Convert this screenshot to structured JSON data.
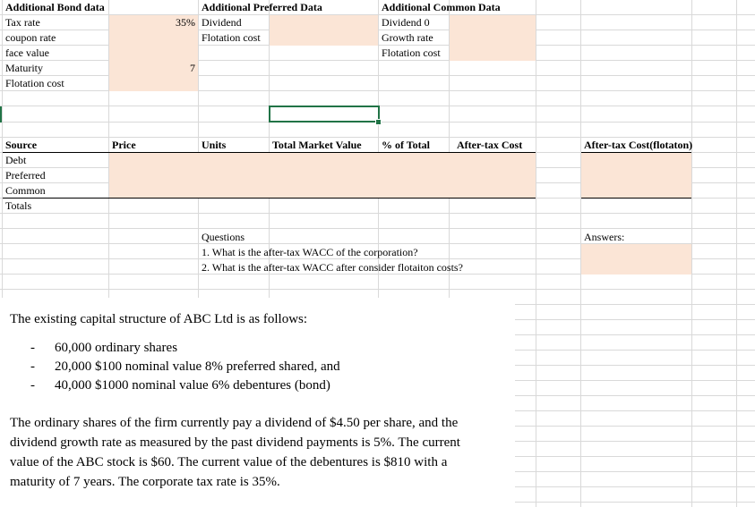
{
  "bond": {
    "header": "Additional Bond data",
    "tax_rate_label": "Tax rate",
    "tax_rate_value": "35%",
    "coupon_rate_label": "coupon rate",
    "face_value_label": "face value",
    "maturity_label": "Maturity",
    "maturity_value": "7",
    "flotation_label": "Flotation cost"
  },
  "preferred": {
    "header": "Additional Preferred Data",
    "dividend_label": "Dividend",
    "flotation_label": "Flotation cost"
  },
  "common": {
    "header": "Additional Common Data",
    "dividend0_label": "Dividend 0",
    "growth_label": "Growth rate",
    "flotation_label": "Flotation cost"
  },
  "table": {
    "headers": {
      "source": "Source",
      "price": "Price",
      "units": "Units",
      "total_market_value": "Total Market Value",
      "pct_total": "% of Total",
      "after_tax_cost": "After-tax Cost",
      "after_tax_cost_flotation": "After-tax Cost(flotaton)"
    },
    "rows": [
      "Debt",
      "Preferred",
      "Common",
      "Totals"
    ]
  },
  "questions": {
    "label": "Questions",
    "q1": "1. What is the after-tax WACC of the corporation?",
    "q2": "2. What is the after-tax WACC after consider flotaiton costs?",
    "answers_label": "Answers:"
  },
  "textbox": {
    "intro": "The existing capital structure of ABC Ltd is as follows:",
    "bullets": [
      "60,000 ordinary shares",
      "20,000 $100 nominal value 8% preferred shared, and",
      "40,000 $1000 nominal value 6% debentures (bond)"
    ],
    "paragraph": [
      "The ordinary shares of the firm currently pay a dividend of $4.50 per share, and the",
      "dividend growth rate as measured by the past dividend payments is 5%. The current",
      "value of the ABC stock is $60. The current value of the debentures is $810 with a",
      "maturity of 7 years. The corporate tax rate is 35%."
    ]
  },
  "colors": {
    "input_fill": "#fbe5d6",
    "selection": "#217346",
    "gridline": "#d4d4d4"
  }
}
